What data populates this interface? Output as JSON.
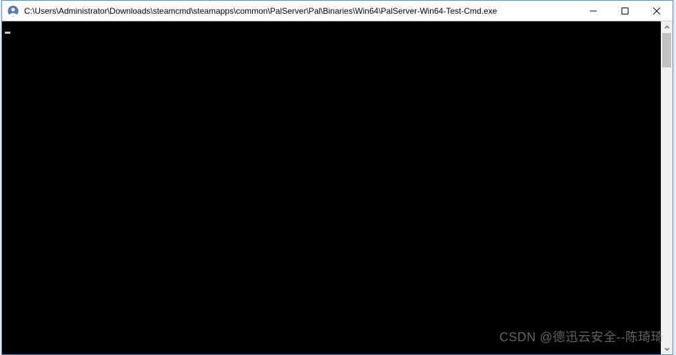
{
  "window": {
    "title": "C:\\Users\\Administrator\\Downloads\\steamcmd\\steamapps\\common\\PalServer\\Pal\\Binaries\\Win64\\PalServer-Win64-Test-Cmd.exe"
  },
  "console": {
    "content": ""
  },
  "watermark": {
    "text": "CSDN @德迅云安全--陈琦琦"
  }
}
